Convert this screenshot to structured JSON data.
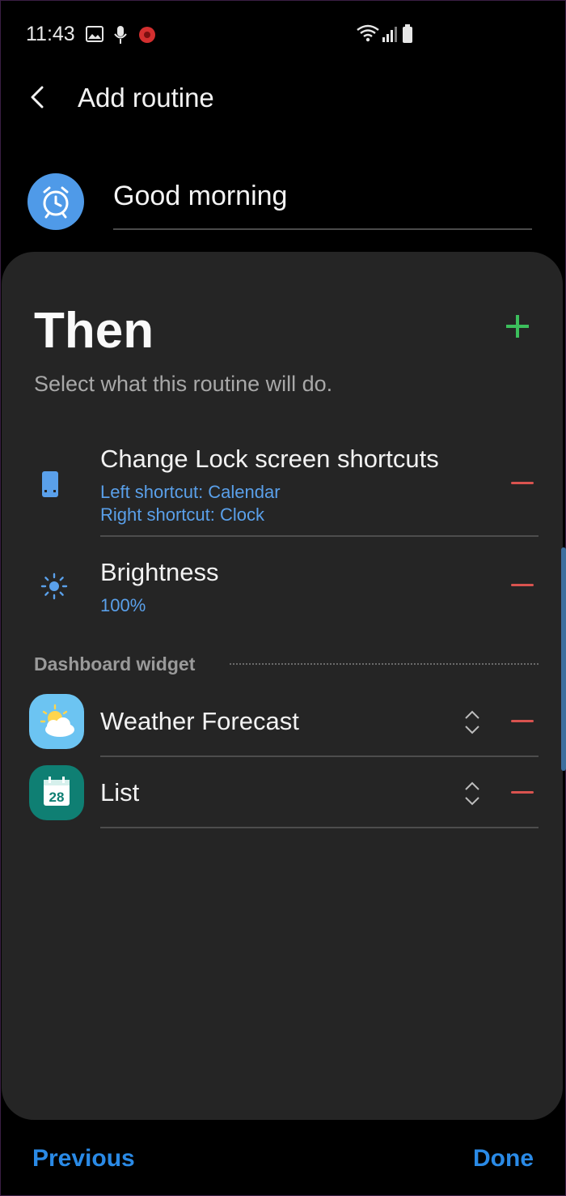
{
  "status_bar": {
    "time": "11:43",
    "icons": [
      "image-icon",
      "mic-icon",
      "red-app-icon",
      "wifi-icon",
      "signal-icon",
      "battery-icon"
    ]
  },
  "header": {
    "title": "Add routine",
    "back_icon": "back-arrow-icon"
  },
  "routine": {
    "name": "Good morning",
    "icon": "alarm-clock-icon",
    "icon_color": "#4f9ae8"
  },
  "then_section": {
    "heading": "Then",
    "subtitle": "Select what this routine will do.",
    "add_icon": "plus-icon",
    "actions": [
      {
        "title": "Change Lock screen shortcuts",
        "details": [
          "Left shortcut: Calendar",
          "Right shortcut: Clock"
        ],
        "icon": "phone-icon"
      },
      {
        "title": "Brightness",
        "details": [
          "100%"
        ],
        "icon": "brightness-icon"
      }
    ]
  },
  "dashboard": {
    "label": "Dashboard widget",
    "widgets": [
      {
        "title": "Weather Forecast",
        "icon": "weather-icon",
        "icon_color": "#6cc4f2"
      },
      {
        "title": "List",
        "icon": "calendar-icon",
        "icon_day": "28",
        "icon_color": "#0f7f73"
      }
    ]
  },
  "footer": {
    "previous_label": "Previous",
    "done_label": "Done"
  },
  "colors": {
    "accent": "#2a8ae6",
    "add": "#3cbf5c",
    "remove": "#d9534f",
    "link_text": "#5aa0ea"
  }
}
